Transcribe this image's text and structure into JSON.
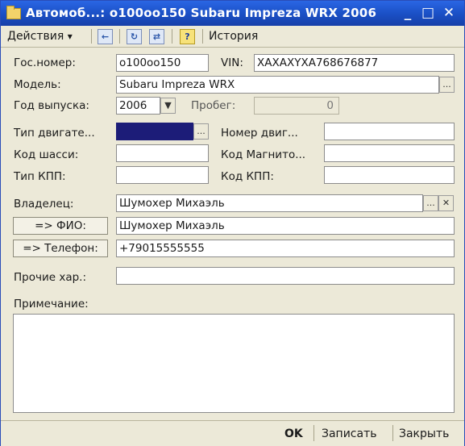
{
  "window": {
    "title": "Автомоб...: о100оо150 Subaru Impreza WRX 2006"
  },
  "title_buttons": {
    "minimize": "_",
    "maximize": "□",
    "close": "✕"
  },
  "toolbar": {
    "actions_label": "Действия",
    "actions_arrow": "▾",
    "history_label": "История",
    "help_glyph": "?"
  },
  "form": {
    "gos_nomer_label": "Гос.номер:",
    "gos_nomer_value": "о100оо150",
    "vin_label": "VIN:",
    "vin_value": "ХАХАХYХА768676877",
    "model_label": "Модель:",
    "model_value": "Subaru Impreza WRX",
    "year_label": "Год выпуска:",
    "year_value": "2006",
    "mileage_label": "Пробег:",
    "mileage_value": "0",
    "engine_type_label": "Тип двигате...",
    "engine_type_value": "",
    "engine_number_label": "Номер двиг...",
    "engine_number_value": "",
    "chassis_label": "Код шасси:",
    "chassis_value": "",
    "magneto_label": "Код Магнито...",
    "magneto_value": "",
    "gearbox_type_label": "Тип КПП:",
    "gearbox_type_value": "",
    "gearbox_code_label": "Код КПП:",
    "gearbox_code_value": "",
    "owner_label": "Владелец:",
    "owner_value": "Шумохер Михаэль",
    "fio_button": "=> ФИО:",
    "fio_value": "Шумохер Михаэль",
    "phone_button": "=> Телефон:",
    "phone_value": "+79015555555",
    "other_label": "Прочие хар.:",
    "other_value": "",
    "note_label": "Примечание:",
    "note_value": ""
  },
  "picker_glyph": "...",
  "clear_glyph": "✕",
  "dropdown_glyph": "▼",
  "footer": {
    "ok_label": "OK",
    "save_label": "Записать",
    "close_label": "Закрыть"
  }
}
